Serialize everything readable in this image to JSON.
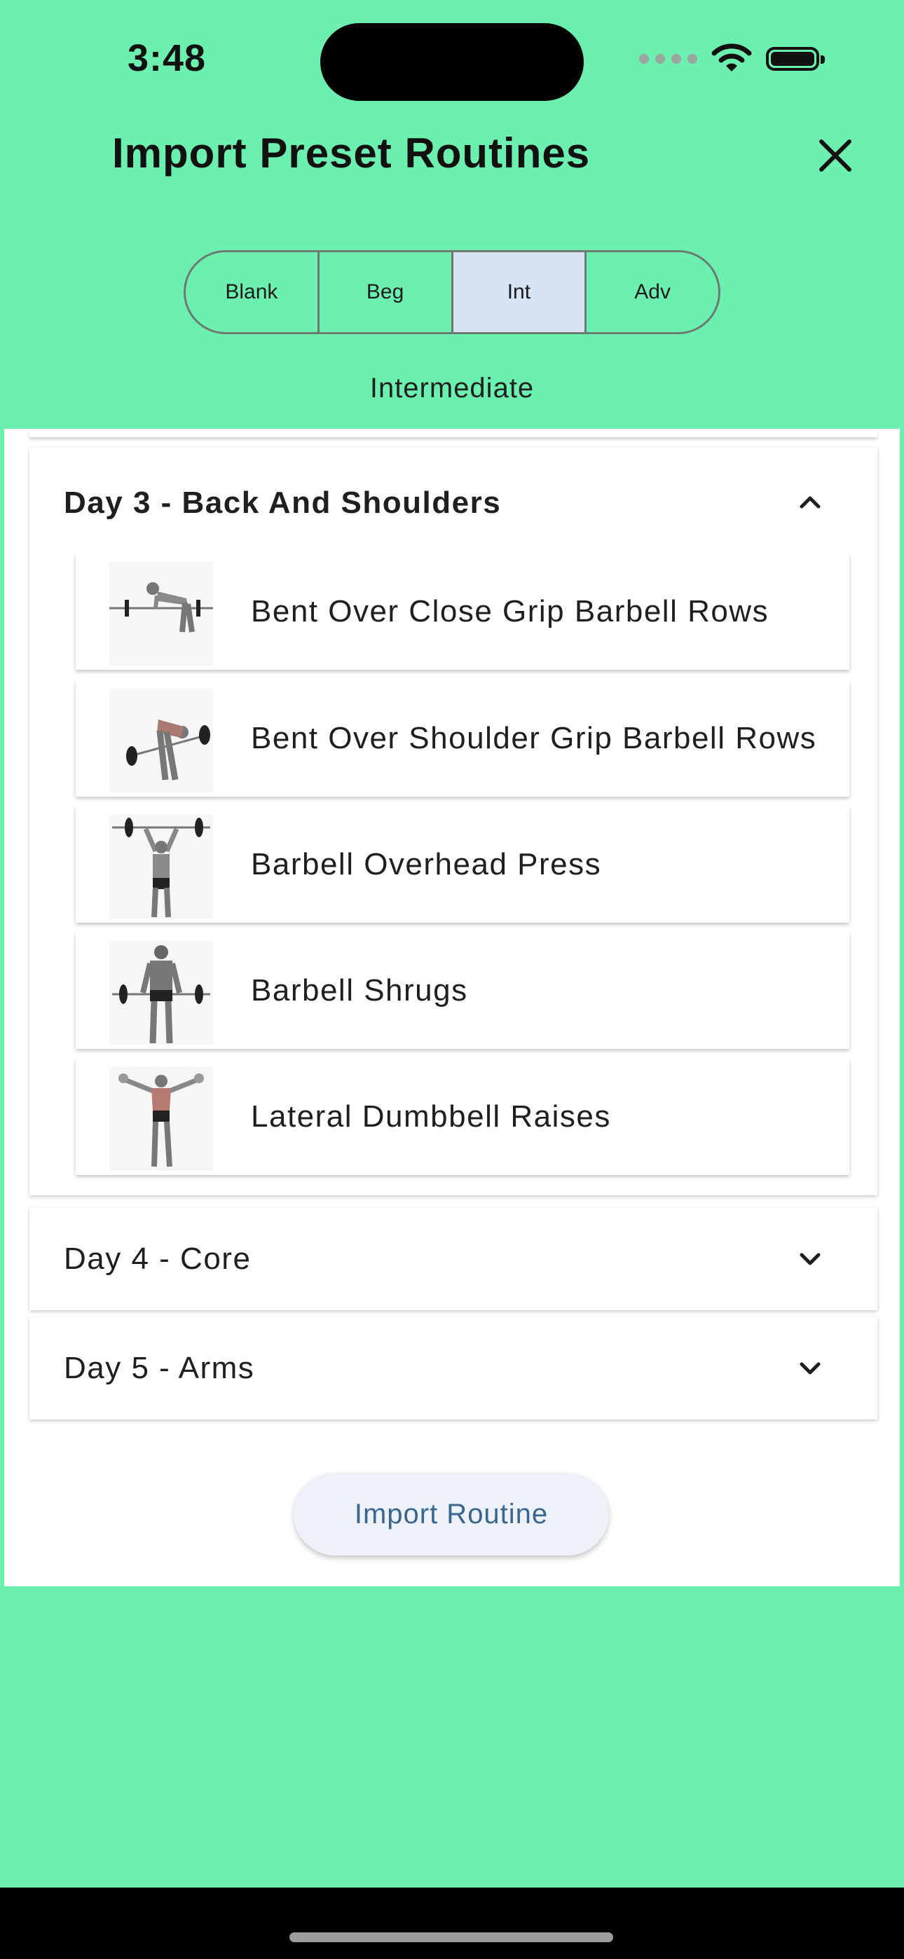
{
  "status_bar": {
    "time": "3:48",
    "icons": [
      "cellular-dots-icon",
      "wifi-icon",
      "battery-icon"
    ]
  },
  "header": {
    "title": "Import Preset Routines",
    "close_icon": "close-icon"
  },
  "segments": [
    {
      "label": "Blank",
      "selected": false
    },
    {
      "label": "Beg",
      "selected": false
    },
    {
      "label": "Int",
      "selected": true
    },
    {
      "label": "Adv",
      "selected": false
    }
  ],
  "level_label": "Intermediate",
  "days": [
    {
      "title": "Day 3 - Back And Shoulders",
      "expanded": true,
      "exercises": [
        {
          "name": "Bent Over Close Grip Barbell Rows"
        },
        {
          "name": "Bent Over Shoulder Grip Barbell Rows"
        },
        {
          "name": "Barbell Overhead Press"
        },
        {
          "name": "Barbell Shrugs"
        },
        {
          "name": "Lateral Dumbbell Raises"
        }
      ]
    },
    {
      "title": "Day 4 - Core",
      "expanded": false
    },
    {
      "title": "Day 5 - Arms",
      "expanded": false
    }
  ],
  "import_button": "Import Routine",
  "colors": {
    "background": "#6cf0b0",
    "selected_segment": "#d6e4f6",
    "button_text": "#3a6790"
  }
}
